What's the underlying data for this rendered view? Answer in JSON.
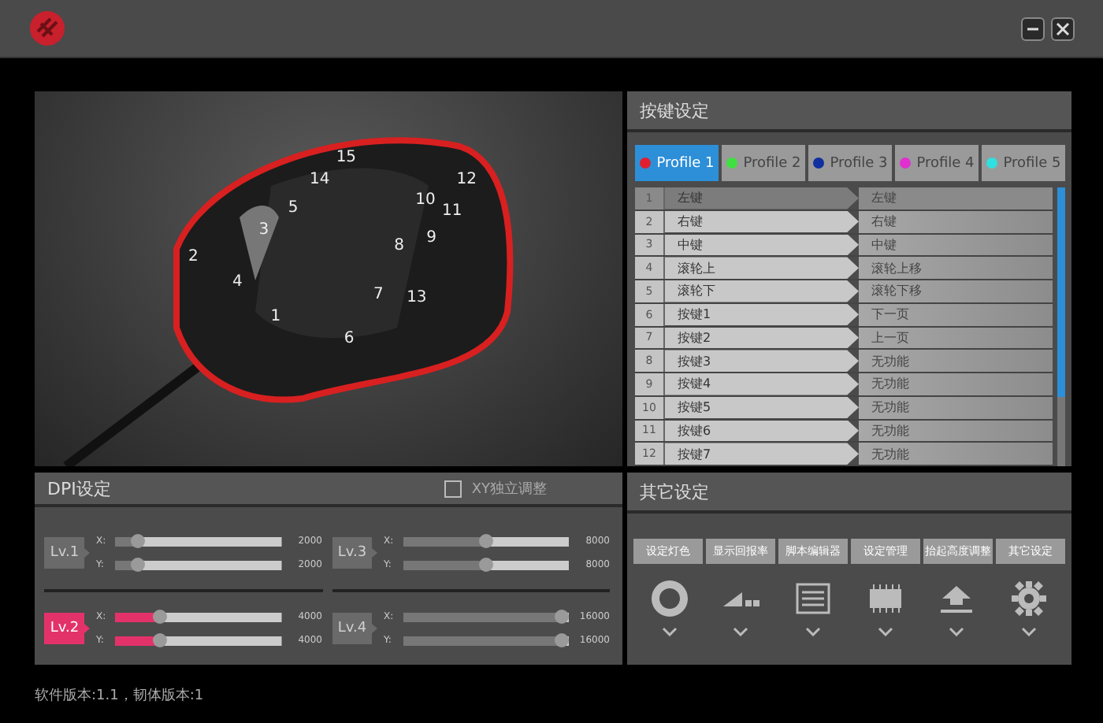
{
  "mouse_view": {
    "callouts": [
      "1",
      "2",
      "3",
      "4",
      "5",
      "6",
      "7",
      "8",
      "9",
      "10",
      "11",
      "12",
      "13",
      "14",
      "15"
    ]
  },
  "key_settings": {
    "title": "按键设定",
    "profiles": [
      {
        "label": "Profile 1",
        "color": "#e02030",
        "selected": true
      },
      {
        "label": "Profile 2",
        "color": "#40e040",
        "selected": false
      },
      {
        "label": "Profile 3",
        "color": "#1030a0",
        "selected": false
      },
      {
        "label": "Profile 4",
        "color": "#e030d0",
        "selected": false
      },
      {
        "label": "Profile 5",
        "color": "#30e0e0",
        "selected": false
      }
    ],
    "rows": [
      {
        "index": "1",
        "key": "左键",
        "function": "左键",
        "selected": true
      },
      {
        "index": "2",
        "key": "右键",
        "function": "右键",
        "selected": false
      },
      {
        "index": "3",
        "key": "中键",
        "function": "中键",
        "selected": false
      },
      {
        "index": "4",
        "key": "滚轮上",
        "function": "滚轮上移",
        "selected": false
      },
      {
        "index": "5",
        "key": "滚轮下",
        "function": "滚轮下移",
        "selected": false
      },
      {
        "index": "6",
        "key": "按键1",
        "function": "下一页",
        "selected": false
      },
      {
        "index": "7",
        "key": "按键2",
        "function": "上一页",
        "selected": false
      },
      {
        "index": "8",
        "key": "按键3",
        "function": "无功能",
        "selected": false
      },
      {
        "index": "9",
        "key": "按键4",
        "function": "无功能",
        "selected": false
      },
      {
        "index": "10",
        "key": "按键5",
        "function": "无功能",
        "selected": false
      },
      {
        "index": "11",
        "key": "按键6",
        "function": "无功能",
        "selected": false
      },
      {
        "index": "12",
        "key": "按键7",
        "function": "无功能",
        "selected": false
      }
    ]
  },
  "dpi_settings": {
    "title": "DPI设定",
    "xy_independent": {
      "label": "XY独立调整",
      "checked": false
    },
    "levels": [
      {
        "label": "Lv.1",
        "selected": false,
        "sliders": [
          {
            "axis": "X:",
            "level": 0.1,
            "value": "2000"
          },
          {
            "axis": "Y:",
            "level": 0.1,
            "value": "2000"
          }
        ]
      },
      {
        "label": "Lv.3",
        "selected": false,
        "sliders": [
          {
            "axis": "X:",
            "level": 0.5,
            "value": "8000"
          },
          {
            "axis": "Y:",
            "level": 0.5,
            "value": "8000"
          }
        ]
      },
      {
        "label": "Lv.2",
        "selected": true,
        "sliders": [
          {
            "axis": "X:",
            "level": 0.25,
            "value": "4000"
          },
          {
            "axis": "Y:",
            "level": 0.25,
            "value": "4000"
          }
        ]
      },
      {
        "label": "Lv.4",
        "selected": false,
        "sliders": [
          {
            "axis": "X:",
            "level": 1,
            "value": "16000"
          },
          {
            "axis": "Y:",
            "level": 1,
            "value": "16000"
          }
        ]
      }
    ]
  },
  "other_settings": {
    "title": "其它设定",
    "items": [
      {
        "label": "设定灯色",
        "kind": "ring"
      },
      {
        "label": "显示回报率",
        "kind": "wedge"
      },
      {
        "label": "脚本编辑器",
        "kind": "list"
      },
      {
        "label": "设定管理",
        "kind": "chip"
      },
      {
        "label": "抬起高度调整",
        "kind": "lift"
      },
      {
        "label": "其它设定",
        "kind": "gear"
      }
    ]
  },
  "status_bar": "软件版本:1.1，韧体版本:1"
}
